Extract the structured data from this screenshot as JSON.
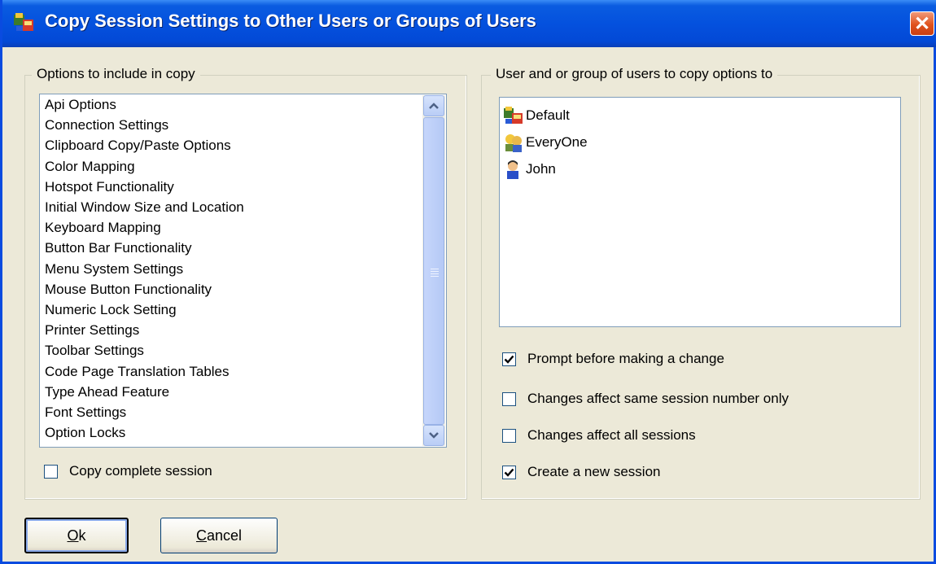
{
  "window": {
    "title": "Copy Session Settings to Other Users or Groups of Users",
    "close_label": "✕"
  },
  "options_group": {
    "legend": "Options to include in copy",
    "items": [
      "Api Options",
      "Connection Settings",
      "Clipboard Copy/Paste Options",
      "Color Mapping",
      "Hotspot Functionality",
      "Initial Window Size and Location",
      "Keyboard Mapping",
      "Button Bar Functionality",
      "Menu System Settings",
      "Mouse Button Functionality",
      "Numeric Lock Setting",
      "Printer Settings",
      "Toolbar Settings",
      "Code Page Translation Tables",
      "Type Ahead Feature",
      "Font Settings",
      "Option Locks"
    ],
    "copy_complete": {
      "label": "Copy complete session",
      "checked": false
    }
  },
  "users_group": {
    "legend": "User and or group of users to copy options to",
    "users": [
      {
        "name": "Default",
        "icon": "group-default-icon"
      },
      {
        "name": "EveryOne",
        "icon": "everyone-group-icon"
      },
      {
        "name": "John",
        "icon": "user-icon"
      }
    ],
    "checkboxes": [
      {
        "label": "Prompt before making a change",
        "checked": true
      },
      {
        "label": "Changes affect same session number only",
        "checked": false
      },
      {
        "label": "Changes affect all sessions",
        "checked": false
      },
      {
        "label": "Create a new session",
        "checked": true
      }
    ]
  },
  "buttons": {
    "ok_accel": "O",
    "ok_rest": "k",
    "cancel_accel": "C",
    "cancel_rest": "ancel"
  },
  "colors": {
    "title_blue": "#0451de",
    "dialog_bg": "#ece9d8",
    "close_red": "#e0521d"
  }
}
